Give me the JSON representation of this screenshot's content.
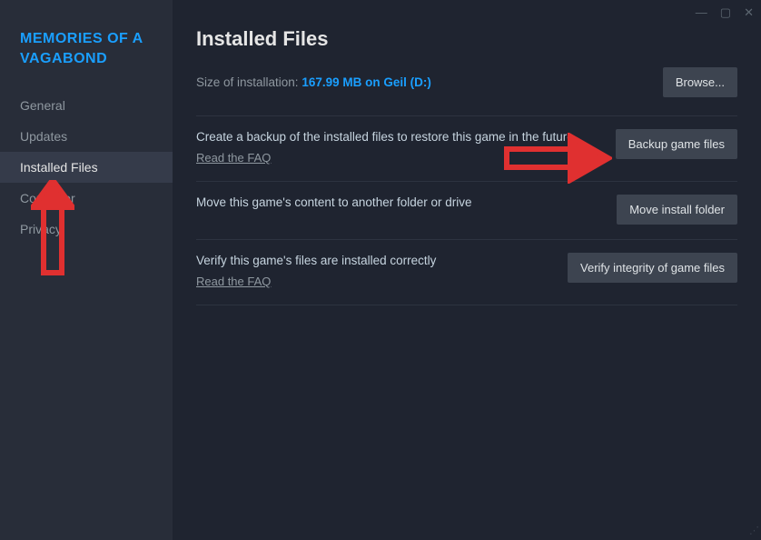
{
  "game_title": "MEMORIES OF A VAGABOND",
  "sidebar": {
    "items": [
      {
        "label": "General"
      },
      {
        "label": "Updates"
      },
      {
        "label": "Installed Files"
      },
      {
        "label": "Controller"
      },
      {
        "label": "Privacy"
      }
    ],
    "active_index": 2
  },
  "main": {
    "title": "Installed Files",
    "size_label": "Size of installation:",
    "size_value": "167.99 MB on Geil (D:)",
    "browse_button": "Browse...",
    "sections": [
      {
        "text": "Create a backup of the installed files to restore this game in the future",
        "faq": "Read the FAQ",
        "button": "Backup game files"
      },
      {
        "text": "Move this game's content to another folder or drive",
        "faq": null,
        "button": "Move install folder"
      },
      {
        "text": "Verify this game's files are installed correctly",
        "faq": "Read the FAQ",
        "button": "Verify integrity of game files"
      }
    ]
  },
  "titlebar": {
    "minimize": "—",
    "maximize": "▢",
    "close": "✕"
  }
}
